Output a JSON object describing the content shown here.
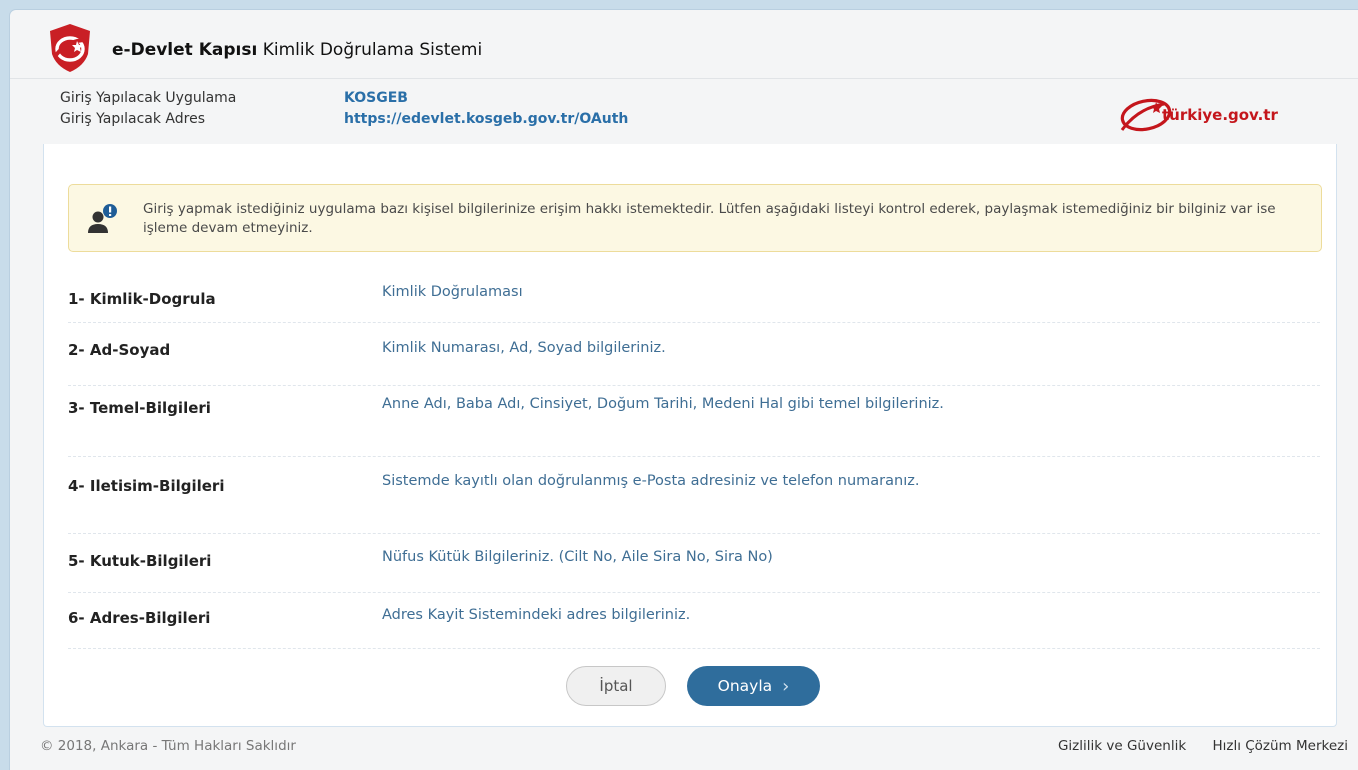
{
  "header": {
    "brand_bold": "e-Devlet Kapısı",
    "brand_rest": " Kimlik Doğrulama Sistemi",
    "app_label": "Giriş Yapılacak Uygulama",
    "address_label": "Giriş Yapılacak Adres",
    "app_value": "KOSGEB",
    "address_value": "https://edevlet.kosgeb.gov.tr/OAuth",
    "turkiye_logo_text": "türkiye.gov.tr"
  },
  "alert": {
    "text": "Giriş yapmak istediğiniz uygulama bazı kişisel bilgilerinize erişim hakkı istemektedir. Lütfen aşağıdaki listeyi kontrol ederek, paylaşmak istemediğiniz bir bilginiz var ise işleme devam etmeyiniz.",
    "icon": "user-alert-icon"
  },
  "permissions": [
    {
      "key": "1- Kimlik-Dogrula",
      "desc": "Kimlik Doğrulaması"
    },
    {
      "key": "2- Ad-Soyad",
      "desc": "Kimlik Numarası, Ad, Soyad bilgileriniz."
    },
    {
      "key": "3- Temel-Bilgileri",
      "desc": "Anne Adı, Baba Adı, Cinsiyet, Doğum Tarihi, Medeni Hal gibi temel bilgileriniz."
    },
    {
      "key": "4- Iletisim-Bilgileri",
      "desc": "Sistemde kayıtlı olan doğrulanmış e-Posta adresiniz ve telefon numaranız."
    },
    {
      "key": "5- Kutuk-Bilgileri",
      "desc": "Nüfus Kütük Bilgileriniz. (Cilt No, Aile Sira No, Sira No)"
    },
    {
      "key": "6- Adres-Bilgileri",
      "desc": "Adres Kayit Sistemindeki adres bilgileriniz."
    }
  ],
  "buttons": {
    "cancel": "İptal",
    "confirm": "Onayla",
    "confirm_chevron": "›"
  },
  "footer": {
    "copyright": "© 2018, Ankara - Tüm Hakları Saklıdır",
    "privacy": "Gizlilik ve Güvenlik",
    "support": "Hızlı Çözüm Merkezi"
  },
  "colors": {
    "primary": "#2f6d9c",
    "link": "#3f6e94",
    "brand_red": "#c4161c",
    "alert_bg": "#fcf8e3"
  }
}
